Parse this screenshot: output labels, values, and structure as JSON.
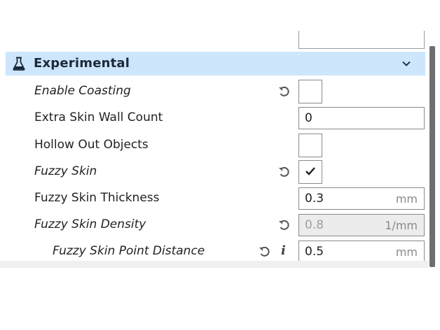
{
  "category": {
    "title": "Experimental",
    "icon": "flask-icon",
    "expanded": true,
    "accent": "#cde6fb"
  },
  "settings": [
    {
      "label": "Enable Coasting",
      "type": "checkbox",
      "checked": false,
      "italic": true,
      "reset": true
    },
    {
      "label": "Extra Skin Wall Count",
      "type": "field",
      "value": "0",
      "unit": "",
      "italic": false
    },
    {
      "label": "Hollow Out Objects",
      "type": "checkbox",
      "checked": false,
      "italic": false
    },
    {
      "label": "Fuzzy Skin",
      "type": "checkbox",
      "checked": true,
      "italic": true,
      "reset": true
    },
    {
      "label": "Fuzzy Skin Thickness",
      "type": "field",
      "value": "0.3",
      "unit": "mm",
      "italic": false
    },
    {
      "label": "Fuzzy Skin Density",
      "type": "field",
      "value": "0.8",
      "unit": "1/mm",
      "italic": true,
      "reset": true,
      "disabled": true
    },
    {
      "label": "Fuzzy Skin Point Distance",
      "type": "field",
      "value": "0.5",
      "unit": "mm",
      "italic": true,
      "reset": true,
      "info": true
    }
  ]
}
